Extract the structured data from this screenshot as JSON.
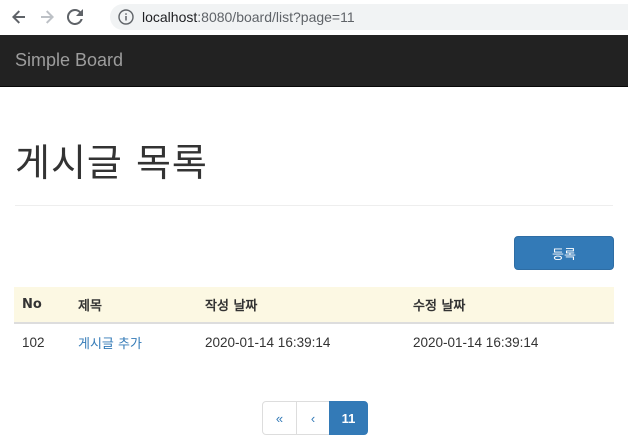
{
  "browser": {
    "url_host": "localhost",
    "url_rest": ":8080/board/list?page=11"
  },
  "navbar": {
    "brand": "Simple Board"
  },
  "page": {
    "title": "게시글 목록",
    "register_button": "등록"
  },
  "table": {
    "headers": [
      "No",
      "제목",
      "작성 날짜",
      "수정 날짜"
    ],
    "rows": [
      {
        "no": "102",
        "title": "게시글 추가",
        "created": "2020-01-14 16:39:14",
        "updated": "2020-01-14 16:39:14"
      }
    ]
  },
  "pagination": {
    "first": "«",
    "prev": "‹",
    "current": "11"
  },
  "colors": {
    "primary": "#337ab7",
    "navbar_bg": "#222222",
    "header_row_bg": "#fcf8e3"
  },
  "icons": [
    "back-arrow-icon",
    "forward-arrow-icon",
    "reload-icon",
    "info-icon"
  ]
}
